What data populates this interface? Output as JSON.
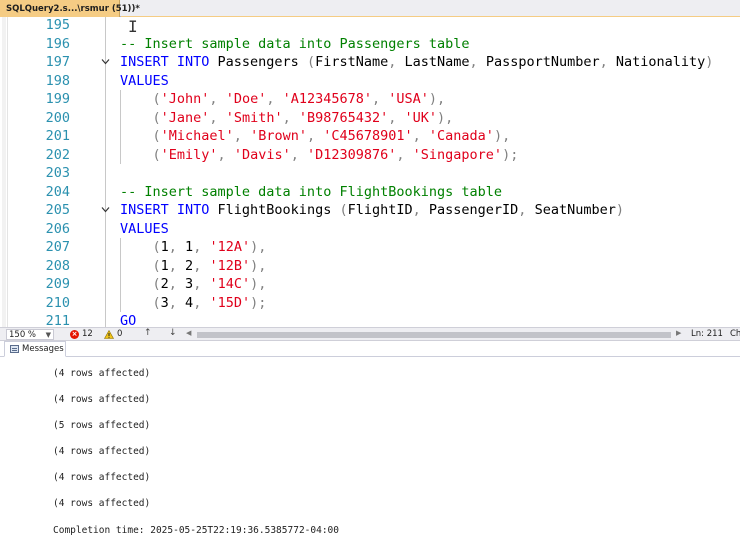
{
  "tab": {
    "title": "SQLQuery2.s...\\rsmur (51))*"
  },
  "editor": {
    "lines": [
      {
        "num": "195",
        "parts": []
      },
      {
        "num": "196",
        "parts": [
          {
            "t": "-- Insert sample data into Passengers table",
            "c": "cmt"
          }
        ]
      },
      {
        "num": "197",
        "fold": true,
        "parts": [
          {
            "t": "INSERT INTO",
            "c": "kw"
          },
          {
            "t": " Passengers ",
            "c": "fn"
          },
          {
            "t": "(",
            "c": "gray"
          },
          {
            "t": "FirstName",
            "c": "fn"
          },
          {
            "t": ", ",
            "c": "gray"
          },
          {
            "t": "LastName",
            "c": "fn"
          },
          {
            "t": ", ",
            "c": "gray"
          },
          {
            "t": "PassportNumber",
            "c": "fn"
          },
          {
            "t": ", ",
            "c": "gray"
          },
          {
            "t": "Nationality",
            "c": "fn"
          },
          {
            "t": ")",
            "c": "gray"
          }
        ]
      },
      {
        "num": "198",
        "parts": [
          {
            "t": "VALUES",
            "c": "kw"
          }
        ]
      },
      {
        "num": "199",
        "parts": [
          {
            "t": "    (",
            "c": "gray"
          },
          {
            "t": "'John'",
            "c": "str"
          },
          {
            "t": ", ",
            "c": "gray"
          },
          {
            "t": "'Doe'",
            "c": "str"
          },
          {
            "t": ", ",
            "c": "gray"
          },
          {
            "t": "'A12345678'",
            "c": "str"
          },
          {
            "t": ", ",
            "c": "gray"
          },
          {
            "t": "'USA'",
            "c": "str"
          },
          {
            "t": "),",
            "c": "gray"
          }
        ]
      },
      {
        "num": "200",
        "parts": [
          {
            "t": "    (",
            "c": "gray"
          },
          {
            "t": "'Jane'",
            "c": "str"
          },
          {
            "t": ", ",
            "c": "gray"
          },
          {
            "t": "'Smith'",
            "c": "str"
          },
          {
            "t": ", ",
            "c": "gray"
          },
          {
            "t": "'B98765432'",
            "c": "str"
          },
          {
            "t": ", ",
            "c": "gray"
          },
          {
            "t": "'UK'",
            "c": "str"
          },
          {
            "t": "),",
            "c": "gray"
          }
        ]
      },
      {
        "num": "201",
        "parts": [
          {
            "t": "    (",
            "c": "gray"
          },
          {
            "t": "'Michael'",
            "c": "str"
          },
          {
            "t": ", ",
            "c": "gray"
          },
          {
            "t": "'Brown'",
            "c": "str"
          },
          {
            "t": ", ",
            "c": "gray"
          },
          {
            "t": "'C45678901'",
            "c": "str"
          },
          {
            "t": ", ",
            "c": "gray"
          },
          {
            "t": "'Canada'",
            "c": "str"
          },
          {
            "t": "),",
            "c": "gray"
          }
        ]
      },
      {
        "num": "202",
        "parts": [
          {
            "t": "    (",
            "c": "gray"
          },
          {
            "t": "'Emily'",
            "c": "str"
          },
          {
            "t": ", ",
            "c": "gray"
          },
          {
            "t": "'Davis'",
            "c": "str"
          },
          {
            "t": ", ",
            "c": "gray"
          },
          {
            "t": "'D12309876'",
            "c": "str"
          },
          {
            "t": ", ",
            "c": "gray"
          },
          {
            "t": "'Singapore'",
            "c": "str"
          },
          {
            "t": ");",
            "c": "gray"
          }
        ]
      },
      {
        "num": "203",
        "parts": []
      },
      {
        "num": "204",
        "parts": [
          {
            "t": "-- Insert sample data into FlightBookings table",
            "c": "cmt"
          }
        ]
      },
      {
        "num": "205",
        "fold": true,
        "parts": [
          {
            "t": "INSERT INTO",
            "c": "kw"
          },
          {
            "t": " FlightBookings ",
            "c": "fn"
          },
          {
            "t": "(",
            "c": "gray"
          },
          {
            "t": "FlightID",
            "c": "fn"
          },
          {
            "t": ", ",
            "c": "gray"
          },
          {
            "t": "PassengerID",
            "c": "fn"
          },
          {
            "t": ", ",
            "c": "gray"
          },
          {
            "t": "SeatNumber",
            "c": "fn"
          },
          {
            "t": ")",
            "c": "gray"
          }
        ]
      },
      {
        "num": "206",
        "parts": [
          {
            "t": "VALUES",
            "c": "kw"
          }
        ]
      },
      {
        "num": "207",
        "parts": [
          {
            "t": "    (",
            "c": "gray"
          },
          {
            "t": "1",
            "c": "fn"
          },
          {
            "t": ", ",
            "c": "gray"
          },
          {
            "t": "1",
            "c": "fn"
          },
          {
            "t": ", ",
            "c": "gray"
          },
          {
            "t": "'12A'",
            "c": "str"
          },
          {
            "t": "),",
            "c": "gray"
          }
        ]
      },
      {
        "num": "208",
        "parts": [
          {
            "t": "    (",
            "c": "gray"
          },
          {
            "t": "1",
            "c": "fn"
          },
          {
            "t": ", ",
            "c": "gray"
          },
          {
            "t": "2",
            "c": "fn"
          },
          {
            "t": ", ",
            "c": "gray"
          },
          {
            "t": "'12B'",
            "c": "str"
          },
          {
            "t": "),",
            "c": "gray"
          }
        ]
      },
      {
        "num": "209",
        "parts": [
          {
            "t": "    (",
            "c": "gray"
          },
          {
            "t": "2",
            "c": "fn"
          },
          {
            "t": ", ",
            "c": "gray"
          },
          {
            "t": "3",
            "c": "fn"
          },
          {
            "t": ", ",
            "c": "gray"
          },
          {
            "t": "'14C'",
            "c": "str"
          },
          {
            "t": "),",
            "c": "gray"
          }
        ]
      },
      {
        "num": "210",
        "parts": [
          {
            "t": "    (",
            "c": "gray"
          },
          {
            "t": "3",
            "c": "fn"
          },
          {
            "t": ", ",
            "c": "gray"
          },
          {
            "t": "4",
            "c": "fn"
          },
          {
            "t": ", ",
            "c": "gray"
          },
          {
            "t": "'15D'",
            "c": "str"
          },
          {
            "t": ");",
            "c": "gray"
          }
        ]
      },
      {
        "num": "211",
        "parts": [
          {
            "t": "GO",
            "c": "kw"
          }
        ]
      }
    ]
  },
  "status": {
    "zoom": "150 %",
    "errors": "12",
    "warnings": "0",
    "line": "Ln: 211",
    "col": "Ch"
  },
  "results": {
    "tab_label": "Messages",
    "messages": [
      "(4 rows affected)",
      "(4 rows affected)",
      "(5 rows affected)",
      "(4 rows affected)",
      "(4 rows affected)",
      "(4 rows affected)",
      "Completion time: 2025-05-25T22:19:36.5385772-04:00"
    ]
  },
  "colors": {
    "keyword": "#0000ff",
    "comment": "#008000",
    "string": "#e0001b",
    "line_number": "#2b91af",
    "tab_active": "#f5cc84"
  }
}
